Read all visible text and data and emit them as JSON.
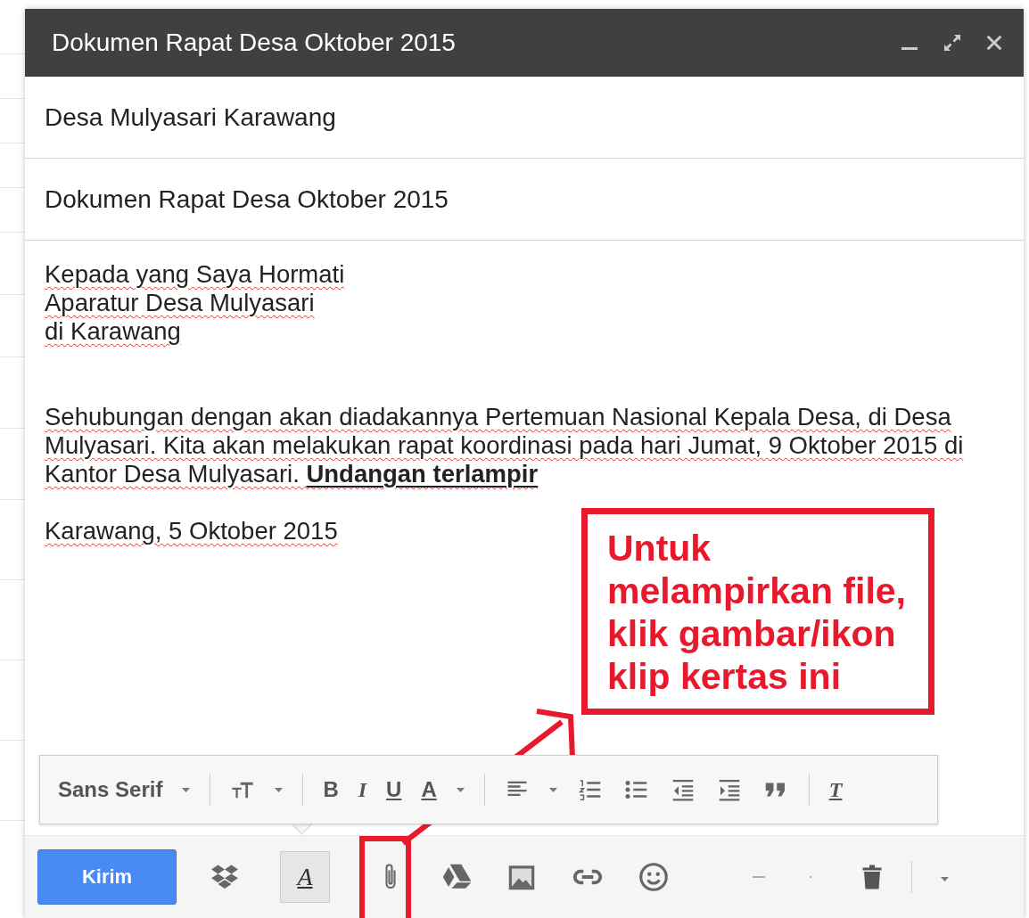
{
  "window": {
    "title": "Dokumen Rapat Desa Oktober 2015"
  },
  "recipient": {
    "value": "Desa Mulyasari Karawang"
  },
  "subject": {
    "value": "Dokumen Rapat Desa Oktober 2015"
  },
  "body": {
    "greeting": [
      "Kepada yang Saya Hormati",
      "Aparatur Desa Mulyasari",
      "di Karawang"
    ],
    "paragraph": "Sehubungan dengan akan diadakannya Pertemuan Nasional Kepala Desa, di Desa Mulyasari. Kita akan melakukan rapat koordinasi pada hari Jumat, 9 Oktober 2015 di Kantor Desa Mulyasari. **Undangan terlampir**",
    "closing": "Karawang, 5 Oktober 2015"
  },
  "format_toolbar": {
    "font": "Sans Serif",
    "bold": "B",
    "italic": "I",
    "underline": "U",
    "text_color": "A",
    "clear_format": "T"
  },
  "bottom_bar": {
    "send": "Kirim",
    "format_toggle": {
      "label": "A",
      "selected": true
    }
  },
  "annotation": {
    "lines": [
      "Untuk",
      "melampirkan file,",
      "klik gambar/ikon",
      "klip kertas ini"
    ]
  }
}
